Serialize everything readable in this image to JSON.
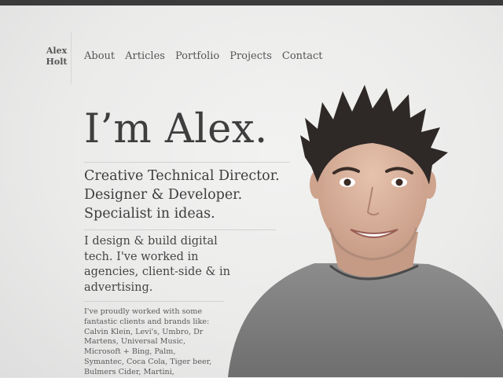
{
  "site": {
    "logo_line1": "Alex",
    "logo_line2": "Holt"
  },
  "nav": {
    "items": [
      "About",
      "Articles",
      "Portfolio",
      "Projects",
      "Contact"
    ]
  },
  "hero": {
    "title": "I’m Alex.",
    "tagline_lines": [
      "Creative Technical Director.",
      "Designer & Developer.",
      "Specialist in ideas."
    ],
    "intro": "I design & build digital tech. I've worked in agencies, client-side & in advertising.",
    "clients": "I've proudly worked with some fantastic clients and brands like: Calvin Klein, Levi's, Umbro, Dr Martens, Universal Music, Microsoft + Bing, Palm, Symantec, Coca Cola, Tiger beer, Bulmers Cider, Martini,"
  },
  "colors": {
    "top_bar": "#3b3b3b",
    "background": "#ebebea",
    "text": "#3d3d3d"
  }
}
